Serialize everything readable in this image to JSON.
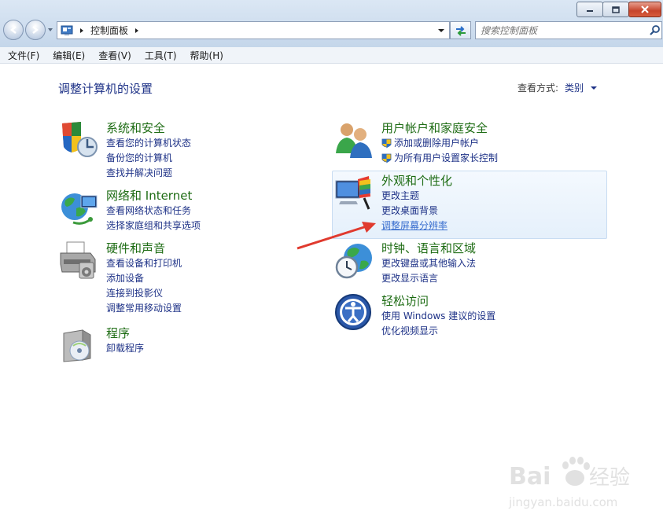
{
  "window": {
    "minimize_icon": "minimize-icon",
    "maximize_icon": "maximize-icon",
    "close_icon": "close-icon"
  },
  "address": {
    "path_segments": [
      "控制面板"
    ]
  },
  "search": {
    "placeholder": "搜索控制面板"
  },
  "menu": [
    "文件(F)",
    "编辑(E)",
    "查看(V)",
    "工具(T)",
    "帮助(H)"
  ],
  "page": {
    "title": "调整计算机的设置",
    "view_by_label": "查看方式:",
    "view_by_value": "类别"
  },
  "categories_left": [
    {
      "title": "系统和安全",
      "links": [
        "查看您的计算机状态",
        "备份您的计算机",
        "查找并解决问题"
      ]
    },
    {
      "title": "网络和 Internet",
      "links": [
        "查看网络状态和任务",
        "选择家庭组和共享选项"
      ]
    },
    {
      "title": "硬件和声音",
      "links": [
        "查看设备和打印机",
        "添加设备",
        "连接到投影仪",
        "调整常用移动设置"
      ]
    },
    {
      "title": "程序",
      "links": [
        "卸载程序"
      ]
    }
  ],
  "categories_right": [
    {
      "title": "用户帐户和家庭安全",
      "links": [
        "添加或删除用户帐户",
        "为所有用户设置家长控制"
      ]
    },
    {
      "title": "外观和个性化",
      "links": [
        "更改主题",
        "更改桌面背景",
        "调整屏幕分辨率"
      ]
    },
    {
      "title": "时钟、语言和区域",
      "links": [
        "更改键盘或其他输入法",
        "更改显示语言"
      ]
    },
    {
      "title": "轻松访问",
      "links": [
        "使用 Windows 建议的设置",
        "优化视频显示"
      ]
    }
  ],
  "watermark": {
    "brand_a": "Bai",
    "brand_b": "经验",
    "url": "jingyan.baidu.com"
  },
  "colors": {
    "title_blue": "#1e3287",
    "category_green": "#1e6c14",
    "arrow_red": "#e03a2e"
  }
}
